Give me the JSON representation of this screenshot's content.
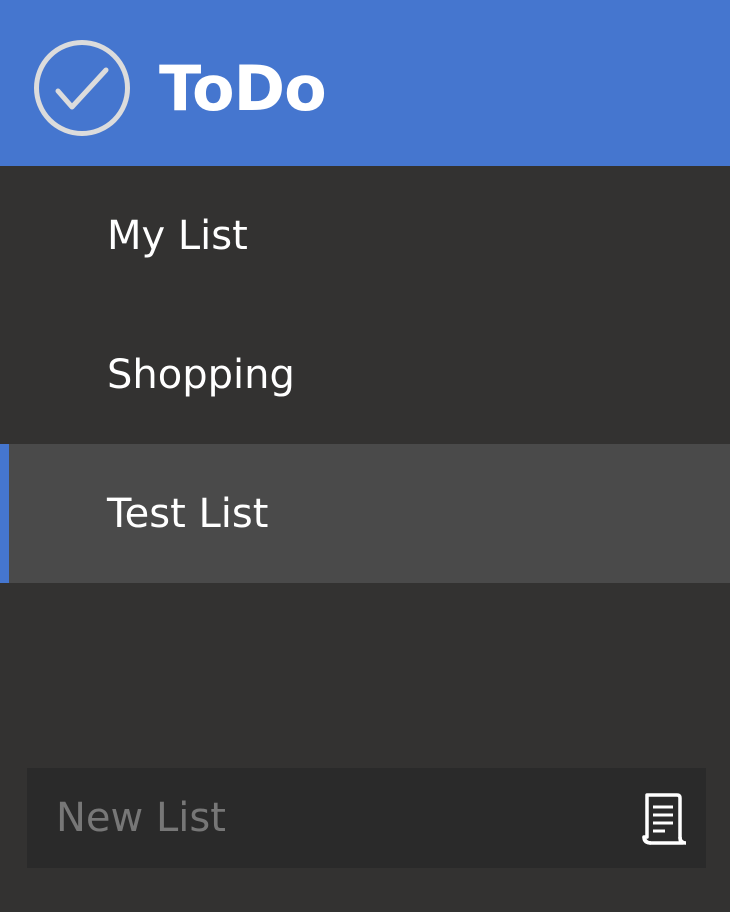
{
  "header": {
    "title": "ToDo",
    "logo_icon": "check-circle-icon",
    "background_color": "#4576cf"
  },
  "lists": [
    {
      "label": "My List",
      "selected": false
    },
    {
      "label": "Shopping",
      "selected": false
    },
    {
      "label": "Test List",
      "selected": true
    }
  ],
  "new_list": {
    "value": "",
    "placeholder": "New List",
    "button_icon": "add-list-scroll-icon"
  },
  "colors": {
    "sidebar_background": "#333231",
    "selected_background": "#4a4a4a",
    "accent": "#4576cf",
    "input_background": "#2a2a2a"
  }
}
